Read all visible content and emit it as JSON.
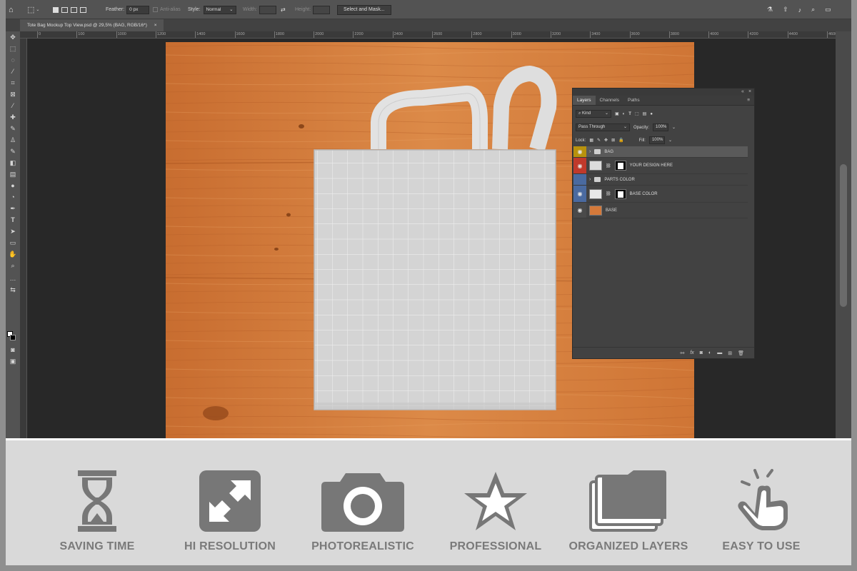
{
  "options_bar": {
    "feather_label": "Feather:",
    "feather_value": "0 px",
    "anti_alias_label": "Anti-alias",
    "style_label": "Style:",
    "style_value": "Normal",
    "width_label": "Width:",
    "height_label": "Height:",
    "select_mask_label": "Select and Mask..."
  },
  "document": {
    "tab_title": "Tote Bag Mockup Top View.psd @ 29,5% (BAG, RGB/16*)",
    "ruler_ticks": [
      "0",
      "100",
      "1000",
      "1200",
      "1400",
      "1600",
      "1800",
      "2000",
      "2200",
      "2400",
      "2600",
      "2800",
      "3000",
      "3200",
      "3400",
      "3600",
      "3800",
      "4000",
      "4200",
      "4400",
      "4600"
    ]
  },
  "layers_panel": {
    "tabs": [
      "Layers",
      "Channels",
      "Paths"
    ],
    "kind_label": "Kind",
    "blend_mode": "Pass Through",
    "opacity_label": "Opacity:",
    "opacity_value": "100%",
    "lock_label": "Lock:",
    "fill_label": "Fill:",
    "fill_value": "100%",
    "layers": [
      {
        "name": "BAG",
        "eye_color": "#b8920d"
      },
      {
        "name": "YOUR DESIGN HERE",
        "eye_color": "#c0392b"
      },
      {
        "name": "PARTS COLOR",
        "eye_color": "#4a6aa0"
      },
      {
        "name": "BASE COLOR",
        "eye_color": "#4a6aa0"
      },
      {
        "name": "BASE",
        "eye_color": "#4a4a4a"
      }
    ]
  },
  "features": [
    {
      "label": "SAVING TIME",
      "icon": "hourglass-icon"
    },
    {
      "label": "HI RESOLUTION",
      "icon": "expand-icon"
    },
    {
      "label": "PHOTOREALISTIC",
      "icon": "camera-icon"
    },
    {
      "label": "PROFESSIONAL",
      "icon": "star-icon"
    },
    {
      "label": "ORGANIZED LAYERS",
      "icon": "layers-folder-icon"
    },
    {
      "label": "EASY TO USE",
      "icon": "pointing-hand-icon"
    }
  ],
  "colors": {
    "accent_gray": "#7a7a7a",
    "wood": "#d4793a"
  }
}
